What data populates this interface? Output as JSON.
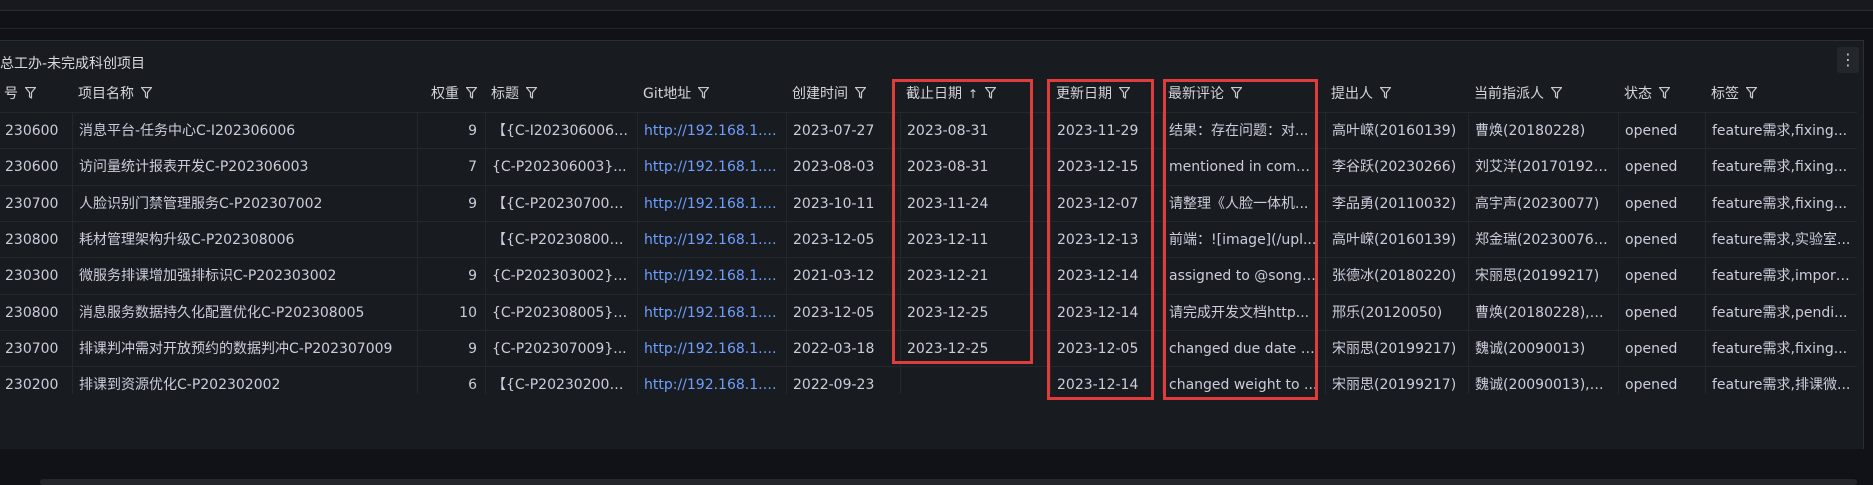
{
  "panel": {
    "title": "总工办-未完成科创项目",
    "menu_icon": "kebab-icon"
  },
  "columns": [
    {
      "key": "id",
      "label": "号"
    },
    {
      "key": "name",
      "label": "项目名称"
    },
    {
      "key": "weight",
      "label": "权重"
    },
    {
      "key": "title",
      "label": "标题"
    },
    {
      "key": "git",
      "label": "Git地址"
    },
    {
      "key": "created",
      "label": "创建时间"
    },
    {
      "key": "due",
      "label": "截止日期",
      "sort": "↑"
    },
    {
      "key": "updated",
      "label": "更新日期"
    },
    {
      "key": "comment",
      "label": "最新评论"
    },
    {
      "key": "proposer",
      "label": "提出人"
    },
    {
      "key": "assignee",
      "label": "当前指派人"
    },
    {
      "key": "status",
      "label": "状态"
    },
    {
      "key": "tags",
      "label": "标签"
    }
  ],
  "rows": [
    {
      "id": "230600",
      "name": "消息平台-任务中心C-I202306006",
      "weight": "9",
      "title": "【{C-I202306006}-...",
      "git": "http://192.168.1.13...",
      "created": "2023-07-27",
      "due": "2023-08-31",
      "updated": "2023-11-29",
      "comment": "结果：存在问题：对...",
      "proposer": "高叶嵘(20160139)",
      "assignee": "曹焕(20180228)",
      "status": "opened",
      "tags": "feature需求,fixing..."
    },
    {
      "id": "230600",
      "name": "访问量统计报表开发C-P202306003",
      "weight": "7",
      "title": "{C-P202306003}...",
      "git": "http://192.168.1.13...",
      "created": "2023-08-03",
      "due": "2023-08-31",
      "updated": "2023-12-15",
      "comment": "mentioned in comm...",
      "proposer": "李谷跃(20230266)",
      "assignee": "刘艾洋(20170192),...",
      "status": "opened",
      "tags": "feature需求,fixing..."
    },
    {
      "id": "230700",
      "name": "人脸识别门禁管理服务C-P202307002",
      "weight": "9",
      "title": "【{C-P2023070022...",
      "git": "http://192.168.1.13...",
      "created": "2023-10-11",
      "due": "2023-11-24",
      "updated": "2023-12-07",
      "comment": "请整理《人脸一体机...",
      "proposer": "李品勇(20110032)",
      "assignee": "高宇声(20230077)",
      "status": "opened",
      "tags": "feature需求,fixing..."
    },
    {
      "id": "230800",
      "name": "耗材管理架构升级C-P202308006",
      "weight": "",
      "title": "【{C-P202308006...",
      "git": "http://192.168.1.13...",
      "created": "2023-12-05",
      "due": "2023-12-11",
      "updated": "2023-12-13",
      "comment": "前端：![image](/upl...",
      "proposer": "高叶嵘(20160139)",
      "assignee": "郑金瑞(20230076)...",
      "status": "opened",
      "tags": "feature需求,实验室..."
    },
    {
      "id": "230300",
      "name": "微服务排课增加强排标识C-P202303002",
      "weight": "9",
      "title": "{C-P202303002}-...",
      "git": "http://192.168.1.13...",
      "created": "2021-03-12",
      "due": "2023-12-21",
      "updated": "2023-12-14",
      "comment": "assigned to @songl...",
      "proposer": "张德冰(20180220)",
      "assignee": "宋丽思(20199217)",
      "status": "opened",
      "tags": "feature需求,import..."
    },
    {
      "id": "230800",
      "name": "消息服务数据持久化配置优化C-P202308005",
      "weight": "10",
      "title": "{C-P202308005}8...",
      "git": "http://192.168.1.13...",
      "created": "2023-12-05",
      "due": "2023-12-25",
      "updated": "2023-12-14",
      "comment": "请完成开发文档http...",
      "proposer": "邢乐(20120050)",
      "assignee": "曹焕(20180228),邢...",
      "status": "opened",
      "tags": "feature需求,pendi..."
    },
    {
      "id": "230700",
      "name": "排课判冲需对开放预约的数据判冲C-P202307009",
      "weight": "9",
      "title": "{C-P202307009}...",
      "git": "http://192.168.1.13...",
      "created": "2022-03-18",
      "due": "2023-12-25",
      "updated": "2023-12-05",
      "comment": "changed due date t...",
      "proposer": "宋丽思(20199217)",
      "assignee": "魏诚(20090013)",
      "status": "opened",
      "tags": "feature需求,fixing..."
    },
    {
      "id": "230200",
      "name": "排课到资源优化C-P202302002",
      "weight": "6",
      "title": "【{C-P202302002...",
      "git": "http://192.168.1.13...",
      "created": "2022-09-23",
      "due": "",
      "updated": "2023-12-14",
      "comment": "changed weight to ...",
      "proposer": "宋丽思(20199217)",
      "assignee": "魏诚(20090013),邢...",
      "status": "opened",
      "tags": "feature需求,排课微..."
    }
  ]
}
